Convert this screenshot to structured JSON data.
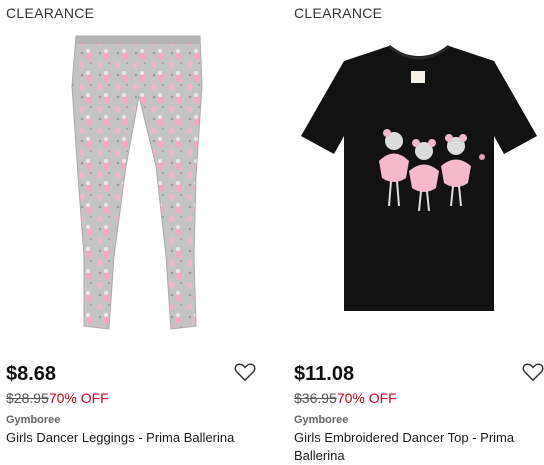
{
  "products": [
    {
      "badge": "CLEARANCE",
      "price": "$8.68",
      "original_price": "$28.95",
      "discount": "70% OFF",
      "brand": "Gymboree",
      "name": "Girls Dancer Leggings - Prima Ballerina",
      "image_icon": "leggings-image"
    },
    {
      "badge": "CLEARANCE",
      "price": "$11.08",
      "original_price": "$36.95",
      "discount": "70% OFF",
      "brand": "Gymboree",
      "name": "Girls Embroidered Dancer Top - Prima Ballerina",
      "image_icon": "tshirt-image"
    }
  ],
  "colors": {
    "discount": "#d0021b",
    "leggings_gray": "#b9b9b9",
    "tshirt_black": "#121212",
    "pink": "#f29bb4"
  }
}
